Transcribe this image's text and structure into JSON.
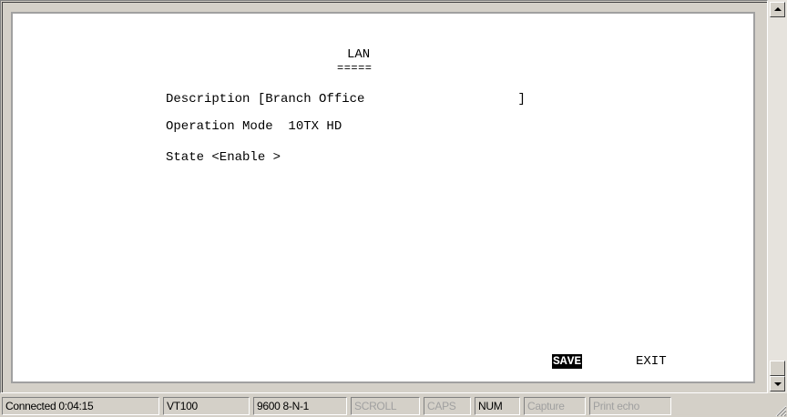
{
  "terminal": {
    "title": "LAN",
    "title_underline": "=====",
    "description_line": "Description [Branch Office                    ]",
    "operation_mode_line": "Operation Mode  10TX HD",
    "state_line": "State <Enable >",
    "save_label": "SAVE",
    "exit_label": "EXIT"
  },
  "status_bar": {
    "connected": "Connected 0:04:15",
    "emulation": "VT100",
    "port_settings": "9600 8-N-1",
    "scroll": "SCROLL",
    "caps": "CAPS",
    "num": "NUM",
    "capture": "Capture",
    "print_echo": "Print echo"
  },
  "colors": {
    "terminal_bg": "#ffffff",
    "chrome": "#d4d0c8",
    "selected_bg": "#000000",
    "selected_fg": "#ffffff",
    "dim_text": "#a0a0a0"
  },
  "icons": {
    "scroll_up": "up-arrow-icon",
    "scroll_down": "down-arrow-icon",
    "size_grip": "size-grip-icon"
  }
}
